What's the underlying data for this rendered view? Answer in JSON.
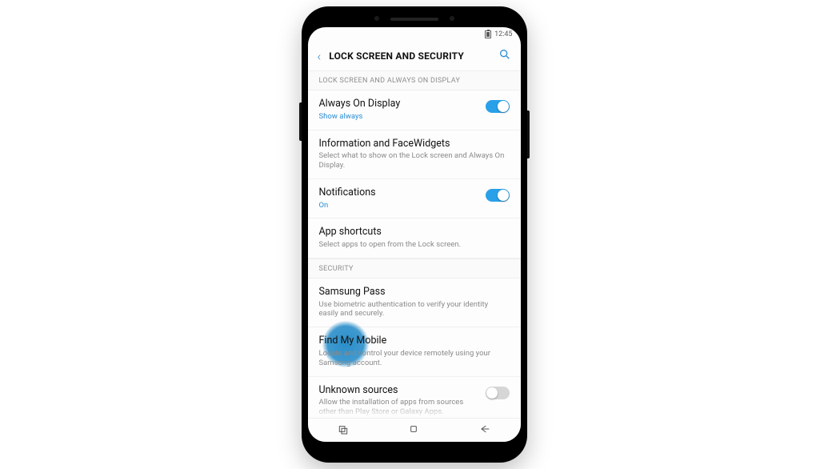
{
  "status": {
    "time": "12:45"
  },
  "header": {
    "title": "LOCK SCREEN AND SECURITY"
  },
  "sections": {
    "display": {
      "label": "LOCK SCREEN AND ALWAYS ON DISPLAY",
      "always_on": {
        "title": "Always On Display",
        "sub": "Show always",
        "toggle": true
      },
      "facewidgets": {
        "title": "Information and FaceWidgets",
        "sub": "Select what to show on the Lock screen and Always On Display."
      },
      "notifications": {
        "title": "Notifications",
        "sub": "On",
        "toggle": true
      },
      "shortcuts": {
        "title": "App shortcuts",
        "sub": "Select apps to open from the Lock screen."
      }
    },
    "security": {
      "label": "SECURITY",
      "samsung_pass": {
        "title": "Samsung Pass",
        "sub": "Use biometric authentication to verify your identity easily and securely."
      },
      "find_my_mobile": {
        "title": "Find My Mobile",
        "sub": "Locate and control your device remotely using your Samsung account."
      },
      "unknown_sources": {
        "title": "Unknown sources",
        "sub": "Allow the installation of apps from sources other than Play Store or Galaxy Apps.",
        "toggle": false
      }
    }
  }
}
